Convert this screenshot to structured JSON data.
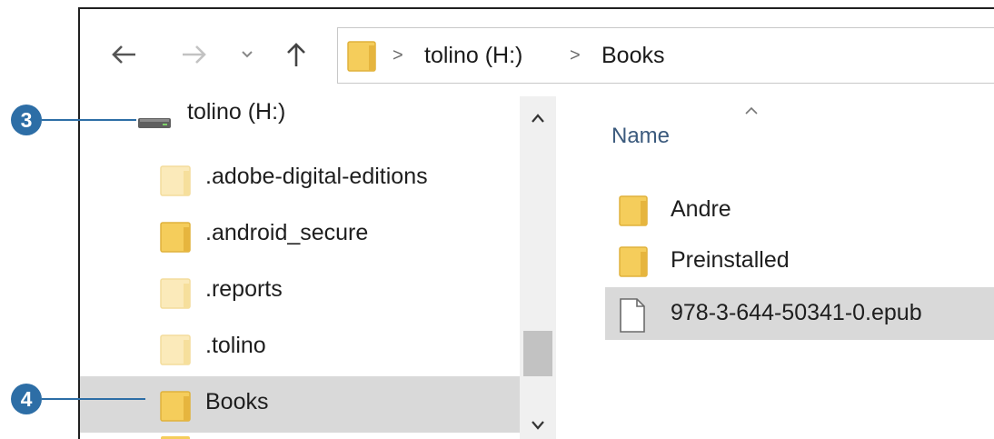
{
  "toolbar": {
    "back_icon": "arrow-left-icon",
    "forward_icon": "arrow-right-icon",
    "recent_icon": "chevron-down-icon",
    "up_icon": "arrow-up-icon"
  },
  "address": {
    "crumbs": [
      "tolino (H:)",
      "Books"
    ],
    "separator": ">"
  },
  "nav": {
    "drive": {
      "label": "tolino (H:)",
      "icon": "drive-icon"
    },
    "items": [
      {
        "label": ".adobe-digital-editions",
        "hidden": true
      },
      {
        "label": ".android_secure",
        "hidden": false
      },
      {
        "label": ".reports",
        "hidden": true
      },
      {
        "label": ".tolino",
        "hidden": true
      },
      {
        "label": "Books",
        "hidden": false,
        "selected": true
      }
    ]
  },
  "content": {
    "column_header": "Name",
    "sort_indicator": "^",
    "items": [
      {
        "label": "Andre",
        "type": "folder"
      },
      {
        "label": "Preinstalled",
        "type": "folder"
      },
      {
        "label": "978-3-644-50341-0.epub",
        "type": "file",
        "selected": true
      }
    ]
  },
  "callouts": [
    {
      "number": "3",
      "target": "tolino (H:)"
    },
    {
      "number": "4",
      "target": "Books"
    }
  ],
  "colors": {
    "callout": "#2d6ea6",
    "folder": "#f5cd5b",
    "hidden_folder": "#fbeaba",
    "selection": "#d9d9d9",
    "header_text": "#3b5a7d"
  }
}
